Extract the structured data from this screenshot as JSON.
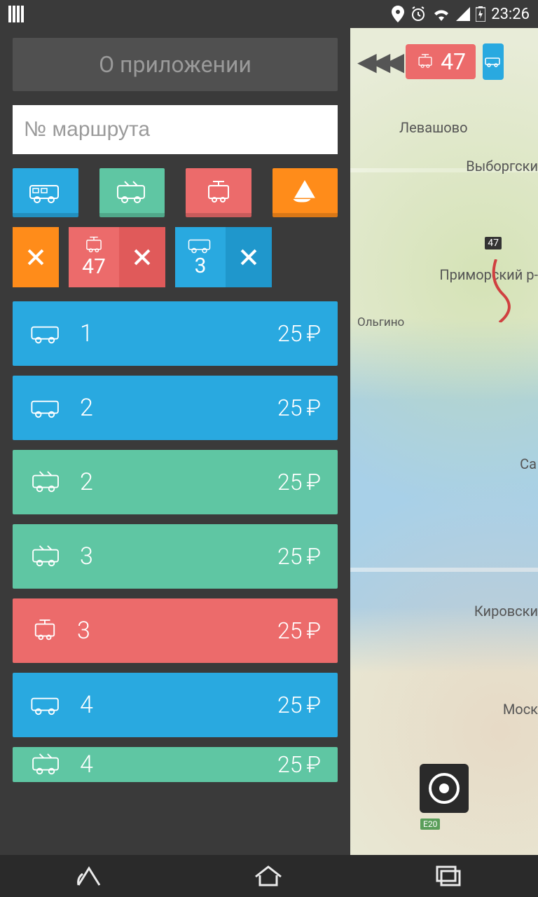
{
  "status": {
    "time": "23:26"
  },
  "sidebar": {
    "about_label": "О приложении",
    "search_placeholder": "№ маршрута",
    "selected": [
      {
        "type": "tram",
        "number": "47",
        "color": "red"
      },
      {
        "type": "bus",
        "number": "3",
        "color": "blue"
      }
    ],
    "routes": [
      {
        "type": "bus",
        "number": "1",
        "price": "25",
        "color": "blue"
      },
      {
        "type": "bus",
        "number": "2",
        "price": "25",
        "color": "blue"
      },
      {
        "type": "trolley",
        "number": "2",
        "price": "25",
        "color": "green"
      },
      {
        "type": "trolley",
        "number": "3",
        "price": "25",
        "color": "green"
      },
      {
        "type": "tram",
        "number": "3",
        "price": "25",
        "color": "red"
      },
      {
        "type": "bus",
        "number": "4",
        "price": "25",
        "color": "blue"
      },
      {
        "type": "trolley",
        "number": "4",
        "price": "25",
        "color": "green"
      }
    ]
  },
  "map": {
    "badge_number": "47",
    "marker": "47",
    "labels": {
      "levashovo": "Левашово",
      "vyborgski": "Выборгски",
      "primorski": "Приморский р-",
      "olgino": "Ольгино",
      "sa": "Са",
      "kirovski": "Кировски",
      "mosk": "Моск",
      "e20": "E20"
    }
  }
}
